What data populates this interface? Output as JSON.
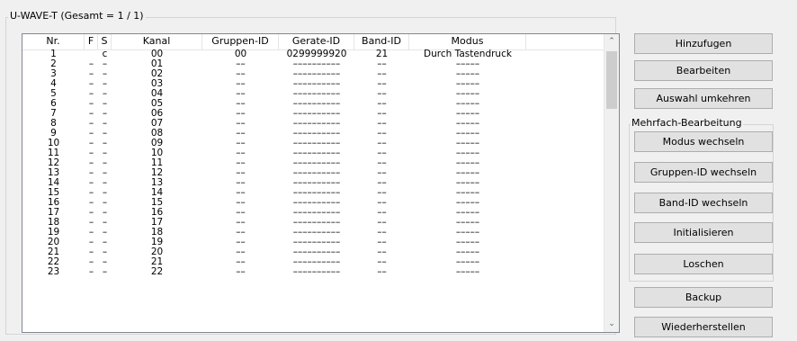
{
  "group_title": "U-WAVE-T (Gesamt = 1 / 1)",
  "table": {
    "headers": [
      "Nr.",
      "F",
      "S",
      "Kanal",
      "Gruppen-ID",
      "Gerate-ID",
      "Band-ID",
      "Modus",
      ""
    ],
    "rows": [
      [
        "1",
        "",
        "c",
        "00",
        "00",
        "0299999920",
        "21",
        "Durch Tastendruck",
        ""
      ],
      [
        "2",
        "–",
        "–",
        "01",
        "––",
        "––––––––––",
        "––",
        "–––––",
        ""
      ],
      [
        "3",
        "–",
        "–",
        "02",
        "––",
        "––––––––––",
        "––",
        "–––––",
        ""
      ],
      [
        "4",
        "–",
        "–",
        "03",
        "––",
        "––––––––––",
        "––",
        "–––––",
        ""
      ],
      [
        "5",
        "–",
        "–",
        "04",
        "––",
        "––––––––––",
        "––",
        "–––––",
        ""
      ],
      [
        "6",
        "–",
        "–",
        "05",
        "––",
        "––––––––––",
        "––",
        "–––––",
        ""
      ],
      [
        "7",
        "–",
        "–",
        "06",
        "––",
        "––––––––––",
        "––",
        "–––––",
        ""
      ],
      [
        "8",
        "–",
        "–",
        "07",
        "––",
        "––––––––––",
        "––",
        "–––––",
        ""
      ],
      [
        "9",
        "–",
        "–",
        "08",
        "––",
        "––––––––––",
        "––",
        "–––––",
        ""
      ],
      [
        "10",
        "–",
        "–",
        "09",
        "––",
        "––––––––––",
        "––",
        "–––––",
        ""
      ],
      [
        "11",
        "–",
        "–",
        "10",
        "––",
        "––––––––––",
        "––",
        "–––––",
        ""
      ],
      [
        "12",
        "–",
        "–",
        "11",
        "––",
        "––––––––––",
        "––",
        "–––––",
        ""
      ],
      [
        "13",
        "–",
        "–",
        "12",
        "––",
        "––––––––––",
        "––",
        "–––––",
        ""
      ],
      [
        "14",
        "–",
        "–",
        "13",
        "––",
        "––––––––––",
        "––",
        "–––––",
        ""
      ],
      [
        "15",
        "–",
        "–",
        "14",
        "––",
        "––––––––––",
        "––",
        "–––––",
        ""
      ],
      [
        "16",
        "–",
        "–",
        "15",
        "––",
        "––––––––––",
        "––",
        "–––––",
        ""
      ],
      [
        "17",
        "–",
        "–",
        "16",
        "––",
        "––––––––––",
        "––",
        "–––––",
        ""
      ],
      [
        "18",
        "–",
        "–",
        "17",
        "––",
        "––––––––––",
        "––",
        "–––––",
        ""
      ],
      [
        "19",
        "–",
        "–",
        "18",
        "––",
        "––––––––––",
        "––",
        "–––––",
        ""
      ],
      [
        "20",
        "–",
        "–",
        "19",
        "––",
        "––––––––––",
        "––",
        "–––––",
        ""
      ],
      [
        "21",
        "–",
        "–",
        "20",
        "––",
        "––––––––––",
        "––",
        "–––––",
        ""
      ],
      [
        "22",
        "–",
        "–",
        "21",
        "––",
        "––––––––––",
        "––",
        "–––––",
        ""
      ],
      [
        "23",
        "–",
        "–",
        "22",
        "––",
        "––––––––––",
        "––",
        "–––––",
        ""
      ]
    ]
  },
  "scrollbar": {
    "up_icon": "chevron-up-icon",
    "down_icon": "chevron-down-icon",
    "up_glyph": "⌃",
    "down_glyph": "⌄"
  },
  "buttons": {
    "add": "Hinzufugen",
    "edit": "Bearbeiten",
    "invert": "Auswahl umkehren",
    "backup": "Backup",
    "restore": "Wiederherstellen"
  },
  "multi_edit": {
    "title": "Mehrfach-Bearbeitung",
    "mode": "Modus wechseln",
    "group": "Gruppen-ID wechseln",
    "band": "Band-ID wechseln",
    "init": "Initialisieren",
    "delete": "Loschen"
  },
  "colors": {
    "background": "#f0f0f0",
    "button": "#e1e1e1",
    "list_border": "#828790"
  }
}
